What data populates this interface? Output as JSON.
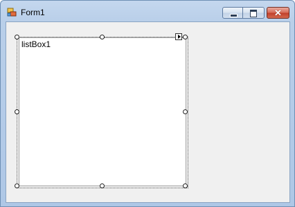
{
  "window": {
    "title": "Form1",
    "icon": "form-icon",
    "controls": {
      "minimize_icon": "minimize-icon",
      "maximize_icon": "maximize-icon",
      "close_icon": "close-icon",
      "close_glyph": "✕"
    }
  },
  "designer": {
    "listbox": {
      "label": "listBox1"
    },
    "smart_tag_icon": "smart-tag-arrow-icon"
  },
  "colors": {
    "titlebar": "#b9cfe9",
    "client_background": "#f0f0f0",
    "close_button": "#c1412c"
  }
}
